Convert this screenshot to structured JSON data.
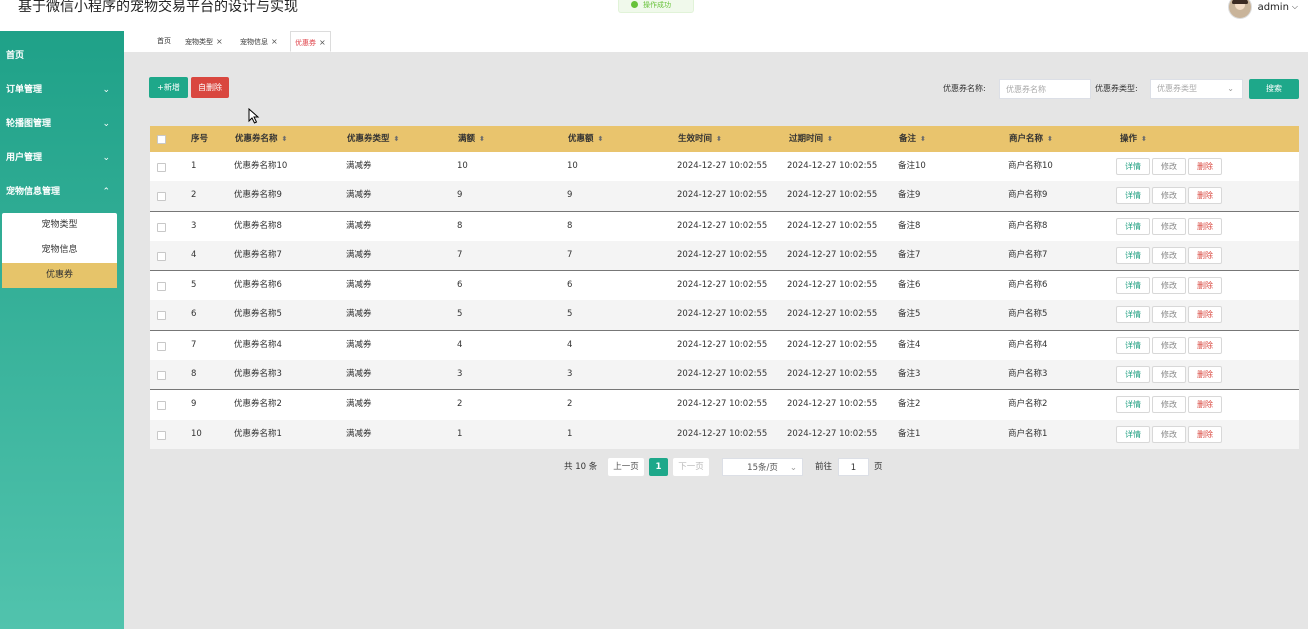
{
  "app_title": "基于微信小程序的宠物交易平台的设计与实现",
  "toast": "操作成功",
  "user": {
    "name": "admin",
    "caret": "⌵"
  },
  "sidebar": {
    "items": [
      {
        "label": "首页",
        "chevron": ""
      },
      {
        "label": "订单管理",
        "chevron": "⌄"
      },
      {
        "label": "轮播图管理",
        "chevron": "⌄"
      },
      {
        "label": "用户管理",
        "chevron": "⌄"
      },
      {
        "label": "宠物信息管理",
        "chevron": "⌃"
      }
    ],
    "submenu": [
      "宠物类型",
      "宠物信息",
      "优惠券"
    ],
    "active_submenu": "优惠券"
  },
  "tabs": [
    {
      "label": "首页",
      "closable": false
    },
    {
      "label": "宠物类型",
      "closable": true
    },
    {
      "label": "宠物信息",
      "closable": true
    },
    {
      "label": "优惠券",
      "closable": true,
      "active": true
    }
  ],
  "tab_close_glyph": "×",
  "toolbar": {
    "add_label": "+新增",
    "delete_label": "自删除"
  },
  "search": {
    "name_label": "优惠券名称:",
    "name_placeholder": "优惠券名称",
    "type_label": "优惠券类型:",
    "type_placeholder": "优惠券类型",
    "button_label": "搜索"
  },
  "table": {
    "columns": [
      "序号",
      "优惠券名称",
      "优惠券类型",
      "满额",
      "优惠额",
      "生效时间",
      "过期时间",
      "备注",
      "商户名称",
      "操作"
    ],
    "sort_glyph": "⬍",
    "action_labels": {
      "detail": "详情",
      "edit": "修改",
      "delete": "删除"
    },
    "rows": [
      {
        "index": "1",
        "name": "优惠券名称10",
        "type": "满减券",
        "full": "10",
        "discount": "10",
        "start": "2024-12-27 10:02:55",
        "end": "2024-12-27 10:02:55",
        "remark": "备注10",
        "merchant": "商户名称10"
      },
      {
        "index": "2",
        "name": "优惠券名称9",
        "type": "满减券",
        "full": "9",
        "discount": "9",
        "start": "2024-12-27 10:02:55",
        "end": "2024-12-27 10:02:55",
        "remark": "备注9",
        "merchant": "商户名称9"
      },
      {
        "index": "3",
        "name": "优惠券名称8",
        "type": "满减券",
        "full": "8",
        "discount": "8",
        "start": "2024-12-27 10:02:55",
        "end": "2024-12-27 10:02:55",
        "remark": "备注8",
        "merchant": "商户名称8"
      },
      {
        "index": "4",
        "name": "优惠券名称7",
        "type": "满减券",
        "full": "7",
        "discount": "7",
        "start": "2024-12-27 10:02:55",
        "end": "2024-12-27 10:02:55",
        "remark": "备注7",
        "merchant": "商户名称7"
      },
      {
        "index": "5",
        "name": "优惠券名称6",
        "type": "满减券",
        "full": "6",
        "discount": "6",
        "start": "2024-12-27 10:02:55",
        "end": "2024-12-27 10:02:55",
        "remark": "备注6",
        "merchant": "商户名称6"
      },
      {
        "index": "6",
        "name": "优惠券名称5",
        "type": "满减券",
        "full": "5",
        "discount": "5",
        "start": "2024-12-27 10:02:55",
        "end": "2024-12-27 10:02:55",
        "remark": "备注5",
        "merchant": "商户名称5"
      },
      {
        "index": "7",
        "name": "优惠券名称4",
        "type": "满减券",
        "full": "4",
        "discount": "4",
        "start": "2024-12-27 10:02:55",
        "end": "2024-12-27 10:02:55",
        "remark": "备注4",
        "merchant": "商户名称4"
      },
      {
        "index": "8",
        "name": "优惠券名称3",
        "type": "满减券",
        "full": "3",
        "discount": "3",
        "start": "2024-12-27 10:02:55",
        "end": "2024-12-27 10:02:55",
        "remark": "备注3",
        "merchant": "商户名称3"
      },
      {
        "index": "9",
        "name": "优惠券名称2",
        "type": "满减券",
        "full": "2",
        "discount": "2",
        "start": "2024-12-27 10:02:55",
        "end": "2024-12-27 10:02:55",
        "remark": "备注2",
        "merchant": "商户名称2"
      },
      {
        "index": "10",
        "name": "优惠券名称1",
        "type": "满减券",
        "full": "1",
        "discount": "1",
        "start": "2024-12-27 10:02:55",
        "end": "2024-12-27 10:02:55",
        "remark": "备注1",
        "merchant": "商户名称1"
      }
    ]
  },
  "pagination": {
    "total_label": "共 10 条",
    "prev_label": "上一页",
    "current_page": "1",
    "next_label": "下一页",
    "page_size_label": "15条/页",
    "goto_label": "前往",
    "goto_value": "1",
    "page_suffix": "页"
  },
  "colors": {
    "accent": "#1ea88a",
    "danger": "#d9473f",
    "table_header": "#e9c46d",
    "active_tab": "#e0454c"
  }
}
